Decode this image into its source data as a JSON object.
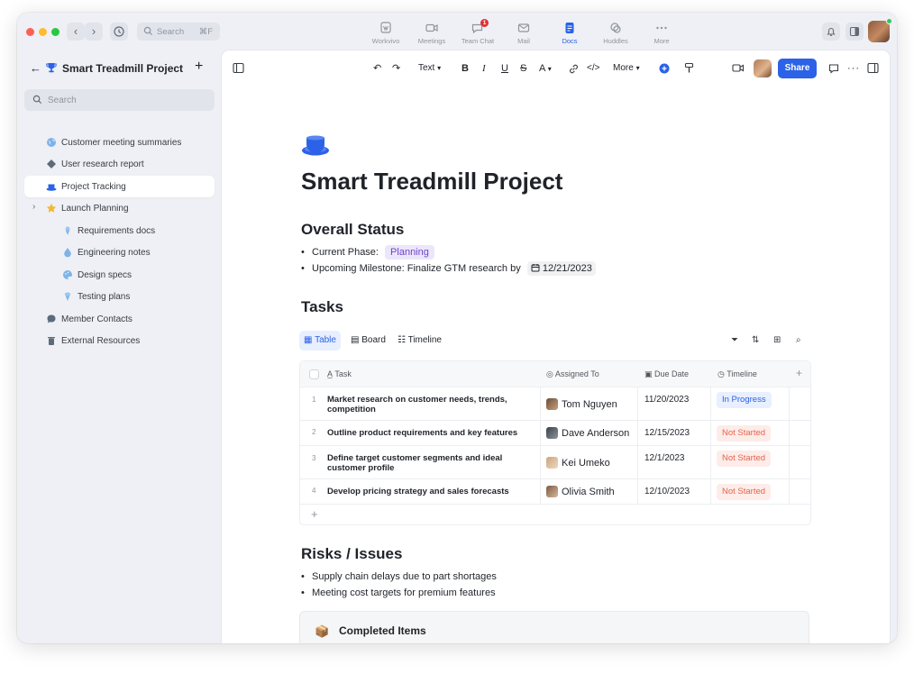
{
  "titlebar": {
    "search_placeholder": "Search",
    "search_shortcut": "⌘F",
    "apps": [
      {
        "label": "Workvivo",
        "icon": "workvivo-icon"
      },
      {
        "label": "Meetings",
        "icon": "video-camera-icon"
      },
      {
        "label": "Team Chat",
        "icon": "chat-icon",
        "badge": "1"
      },
      {
        "label": "Mail",
        "icon": "mail-icon"
      },
      {
        "label": "Docs",
        "icon": "docs-icon",
        "active": true
      },
      {
        "label": "Huddles",
        "icon": "huddles-icon"
      },
      {
        "label": "More",
        "icon": "more-dots-icon"
      }
    ]
  },
  "sidebar": {
    "title": "Smart Treadmill Project",
    "search_placeholder": "Search",
    "items": [
      {
        "label": "Customer meeting summaries",
        "icon": "globe-icon"
      },
      {
        "label": "User research report",
        "icon": "puzzle-icon"
      },
      {
        "label": "Project Tracking",
        "icon": "cup-icon",
        "selected": true
      },
      {
        "label": "Launch Planning",
        "icon": "star-icon",
        "expandable": true
      },
      {
        "label": "Requirements docs",
        "icon": "ice-cream-icon",
        "child": true
      },
      {
        "label": "Engineering notes",
        "icon": "water-drop-icon",
        "child": true
      },
      {
        "label": "Design specs",
        "icon": "palette-icon",
        "child": true
      },
      {
        "label": "Testing plans",
        "icon": "ice-cream-icon",
        "child": true
      },
      {
        "label": "Member Contacts",
        "icon": "chat-bubble-icon"
      },
      {
        "label": "External Resources",
        "icon": "trash-bin-icon"
      }
    ]
  },
  "toolbar": {
    "text_style": "Text",
    "more_label": "More",
    "share_label": "Share"
  },
  "doc": {
    "title": "Smart Treadmill Project",
    "overall_status": {
      "heading": "Overall Status",
      "phase_label": "Current Phase:",
      "phase_value": "Planning",
      "milestone_label": "Upcoming Milestone: Finalize GTM research by",
      "milestone_date": "12/21/2023"
    },
    "tasks": {
      "heading": "Tasks",
      "views": [
        "Table",
        "Board",
        "Timeline"
      ],
      "columns": [
        "Task",
        "Assigned To",
        "Due Date",
        "Timeline"
      ],
      "rows": [
        {
          "num": "1",
          "task": "Market research on customer needs, trends, competition",
          "assignee": "Tom Nguyen",
          "due": "11/20/2023",
          "status": "In Progress"
        },
        {
          "num": "2",
          "task": "Outline product requirements and key features",
          "assignee": "Dave Anderson",
          "due": "12/15/2023",
          "status": "Not Started"
        },
        {
          "num": "3",
          "task": "Define target customer segments and ideal customer profile",
          "assignee": "Kei Umeko",
          "due": "12/1/2023",
          "status": "Not Started"
        },
        {
          "num": "4",
          "task": "Develop pricing strategy and sales forecasts",
          "assignee": "Olivia Smith",
          "due": "12/10/2023",
          "status": "Not Started"
        }
      ]
    },
    "risks": {
      "heading": "Risks / Issues",
      "items": [
        "Supply chain delays due to part shortages",
        "Meeting cost targets for premium features"
      ]
    },
    "completed": {
      "label": "Completed Items"
    }
  },
  "colors": {
    "accent": "#2b62e8",
    "in_progress_bg": "#e8effe",
    "not_started_bg": "#fdece9",
    "not_started_text": "#e5664a",
    "phase_tag_bg": "#ece6fb"
  }
}
